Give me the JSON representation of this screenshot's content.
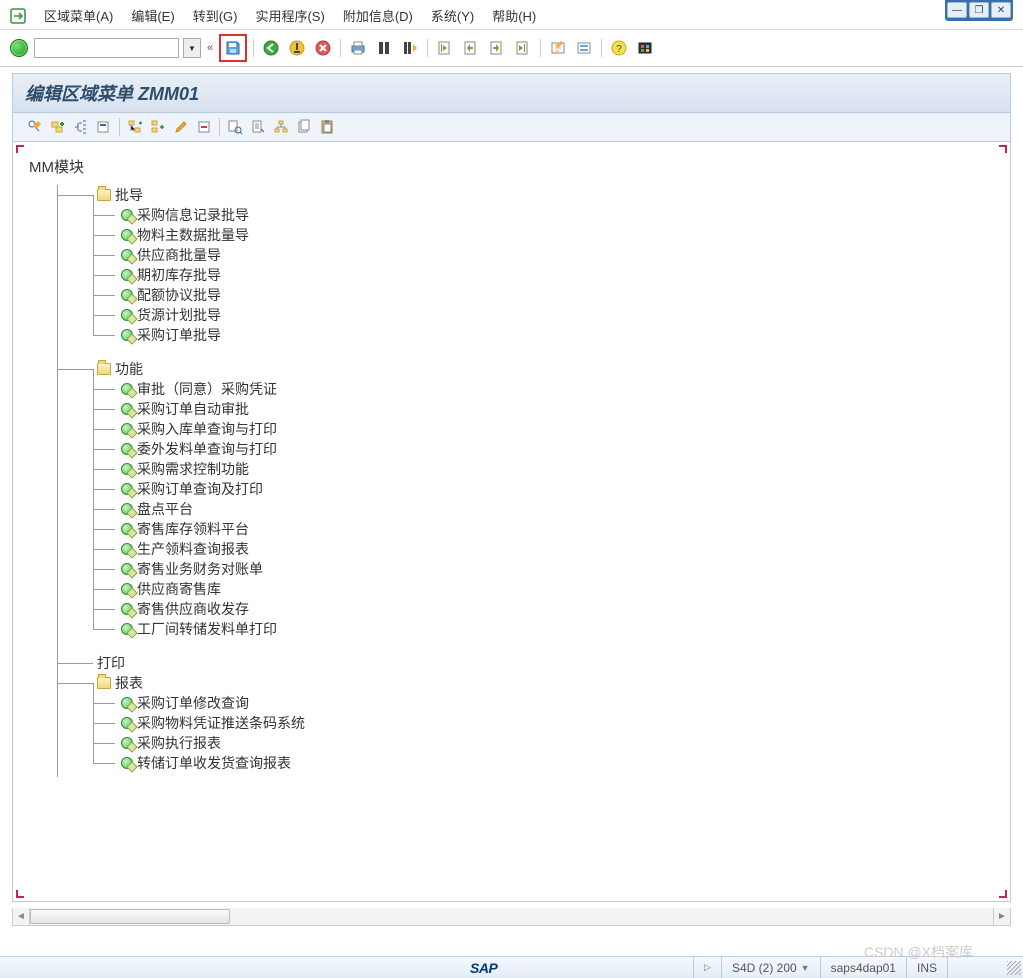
{
  "window_controls": {
    "minimize": "—",
    "restore": "❐",
    "close": "✕"
  },
  "menus": [
    "区域菜单(A)",
    "编辑(E)",
    "转到(G)",
    "实用程序(S)",
    "附加信息(D)",
    "系统(Y)",
    "帮助(H)"
  ],
  "toolbar_cmd_value": "",
  "double_chevron": "«",
  "page_title": "编辑区域菜单 ZMM01",
  "tree": {
    "root": "MM模块",
    "groups": [
      {
        "type": "folder",
        "label": "批导",
        "children": [
          "采购信息记录批导",
          "物料主数据批量导",
          "供应商批量导",
          "期初库存批导",
          "配额协议批导",
          "货源计划批导",
          "采购订单批导"
        ]
      },
      {
        "type": "folder",
        "label": "功能",
        "children": [
          "审批（同意）采购凭证",
          "采购订单自动审批",
          "采购入库单查询与打印",
          "委外发料单查询与打印",
          "采购需求控制功能",
          "采购订单查询及打印",
          "盘点平台",
          "寄售库存领料平台",
          "生产领料查询报表",
          "寄售业务财务对账单",
          "供应商寄售库",
          "寄售供应商收发存",
          "工厂间转储发料单打印"
        ]
      },
      {
        "type": "label",
        "label": "打印"
      },
      {
        "type": "folder",
        "label": "报表",
        "children": [
          "采购订单修改查询",
          "采购物料凭证推送条码系统",
          "采购执行报表",
          "转储订单收发货查询报表"
        ]
      }
    ]
  },
  "statusbar": {
    "sap": "SAP",
    "sys": "S4D (2) 200",
    "host": "saps4dap01",
    "mode": "INS"
  },
  "watermark": "CSDN @X档案库"
}
